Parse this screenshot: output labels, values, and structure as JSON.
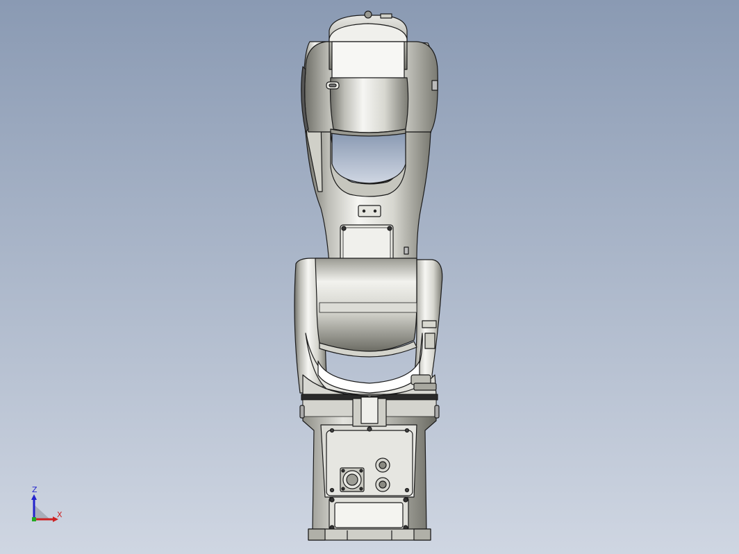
{
  "view": {
    "background_top": "#8c9cb4",
    "background_bottom": "#ccd4e0",
    "model_fill_light": "#f4f4f2",
    "model_fill_dark": "#6e6e66",
    "edge_color": "#1a1a1a"
  },
  "triad": {
    "z_label": "Z",
    "x_label": "X",
    "z_color": "#2222cc",
    "x_color": "#cc2222",
    "y_color": "#22aa22"
  },
  "model": {
    "name": "six-axis-robot-arm",
    "view_orientation": "front"
  }
}
